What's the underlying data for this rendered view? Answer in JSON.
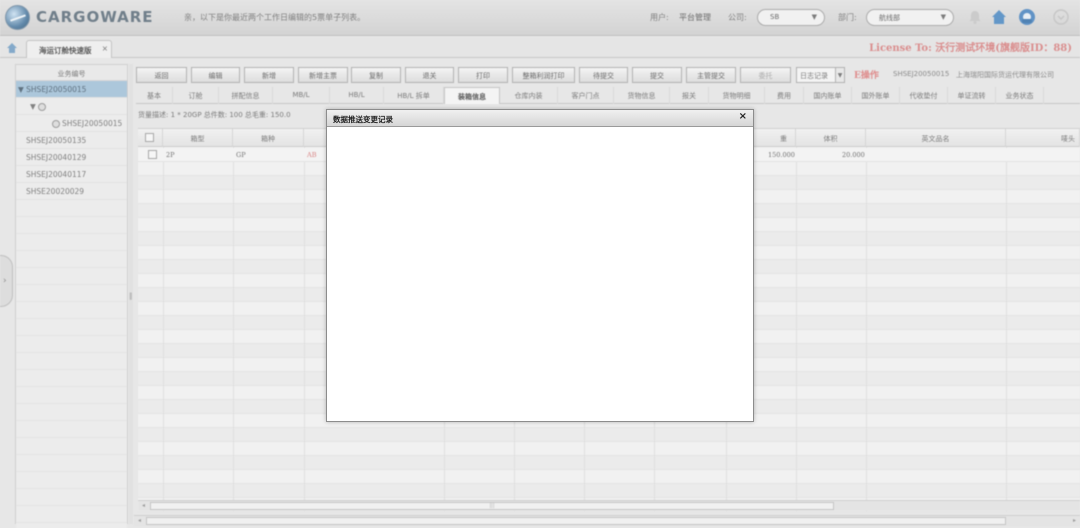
{
  "header": {
    "brand": "CARGOWARE",
    "notice": "亲，以下是你最近两个工作日编辑的5票单子列表。",
    "user_label": "用户:",
    "user_value": "平台管理",
    "company_label": "公司:",
    "company_value": "SB",
    "dept_label": "部门:",
    "dept_value": "航线部"
  },
  "tabs": {
    "active_tab": "海运订舱快速版",
    "close_glyph": "×",
    "license": "License To: 沃行测试环境(旗舰版ID：88)"
  },
  "left_panel": {
    "header": "业务编号",
    "selected": "SHSEJ20050015",
    "child_glyph": "▼",
    "grandchild": "SHSEJ20050015",
    "items": [
      "SHSEJ20050135",
      "SHSEJ20040129",
      "SHSEJ20040117",
      "SHSE20020029"
    ]
  },
  "toolbar": {
    "buttons": [
      "返回",
      "编辑",
      "新增",
      "新增主票",
      "复制",
      "退关",
      "打印",
      "整箱利润打印",
      "待提交",
      "提交",
      "主管提交",
      "委托"
    ],
    "log_select": "日志记录",
    "danger_label": "E操作",
    "order_info": "SHSEJ20050015",
    "company_info": "上海瑞阳国际货运代理有限公司"
  },
  "subtabs": [
    "基本",
    "订舱",
    "拼配信息",
    "MB/L",
    "HB/L",
    "HB/L 拆单",
    "装箱信息",
    "仓库内装",
    "客户门点",
    "货物信息",
    "报关",
    "货物明细",
    "费用",
    "国内账单",
    "国外账单",
    "代收垫付",
    "单证流转",
    "业务状态"
  ],
  "active_subtab": "装箱信息",
  "summary": "货量描述: 1 * 20GP 总件数: 100 总毛重: 150.0",
  "grid": {
    "columns": [
      "箱型",
      "箱种",
      "",
      "",
      "",
      "",
      "",
      "",
      "重",
      "体积",
      "英文品名",
      "唛头"
    ],
    "row": {
      "type": "2P",
      "kind": "GP",
      "flag": "AB",
      "weight": "150.000",
      "volume": "20.000"
    }
  },
  "modal": {
    "title": "数据推送变更记录",
    "close": "×"
  },
  "colors": {
    "selected_row": "#a9c5da",
    "license_text": "#d98a8a"
  }
}
